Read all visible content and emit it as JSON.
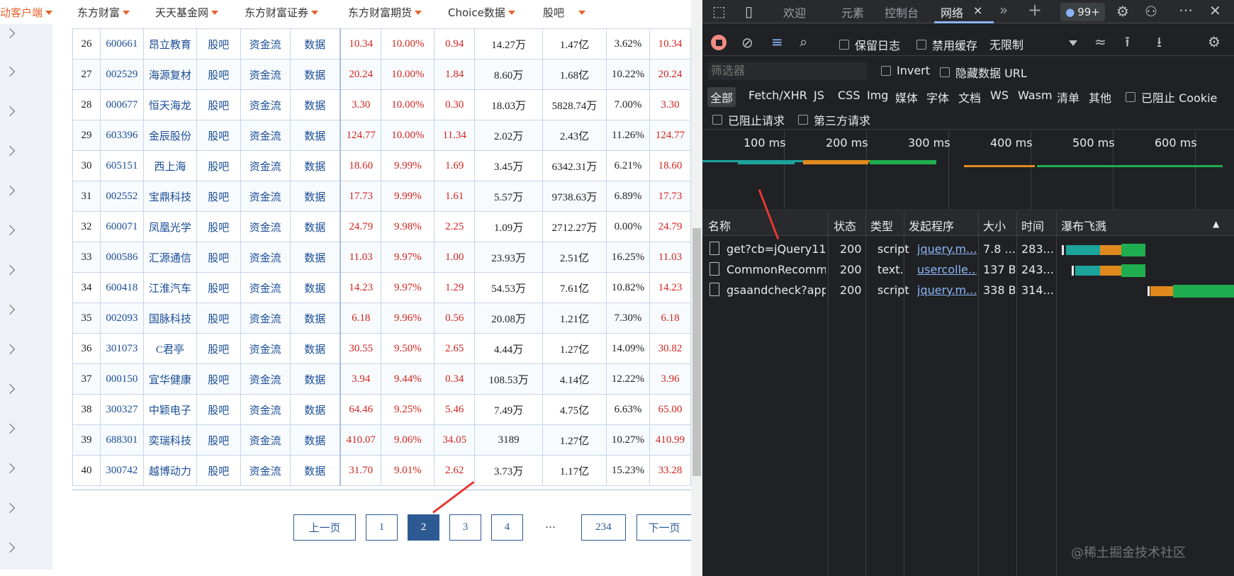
{
  "topnav": {
    "items": [
      "动客户端",
      "东方财富",
      "天天基金网",
      "东方财富证券",
      "东方财富期货",
      "Choice数据",
      "股吧"
    ]
  },
  "table": {
    "rows": [
      [
        "26",
        "600661",
        "昂立教育",
        "股吧",
        "资金流",
        "数据",
        "10.34",
        "10.00%",
        "0.94",
        "14.27万",
        "1.47亿",
        "3.62%",
        "10.34"
      ],
      [
        "27",
        "002529",
        "海源复材",
        "股吧",
        "资金流",
        "数据",
        "20.24",
        "10.00%",
        "1.84",
        "8.60万",
        "1.68亿",
        "10.22%",
        "20.24"
      ],
      [
        "28",
        "000677",
        "恒天海龙",
        "股吧",
        "资金流",
        "数据",
        "3.30",
        "10.00%",
        "0.30",
        "18.03万",
        "5828.74万",
        "7.00%",
        "3.30"
      ],
      [
        "29",
        "603396",
        "金辰股份",
        "股吧",
        "资金流",
        "数据",
        "124.77",
        "10.00%",
        "11.34",
        "2.02万",
        "2.43亿",
        "11.26%",
        "124.77"
      ],
      [
        "30",
        "605151",
        "西上海",
        "股吧",
        "资金流",
        "数据",
        "18.60",
        "9.99%",
        "1.69",
        "3.45万",
        "6342.31万",
        "6.21%",
        "18.60"
      ],
      [
        "31",
        "002552",
        "宝鼎科技",
        "股吧",
        "资金流",
        "数据",
        "17.73",
        "9.99%",
        "1.61",
        "5.57万",
        "9738.63万",
        "6.89%",
        "17.73"
      ],
      [
        "32",
        "600071",
        "凤凰光学",
        "股吧",
        "资金流",
        "数据",
        "24.79",
        "9.98%",
        "2.25",
        "1.09万",
        "2712.27万",
        "0.00%",
        "24.79"
      ],
      [
        "33",
        "000586",
        "汇源通信",
        "股吧",
        "资金流",
        "数据",
        "11.03",
        "9.97%",
        "1.00",
        "23.93万",
        "2.51亿",
        "16.25%",
        "11.03"
      ],
      [
        "34",
        "600418",
        "江淮汽车",
        "股吧",
        "资金流",
        "数据",
        "14.23",
        "9.97%",
        "1.29",
        "54.53万",
        "7.61亿",
        "10.82%",
        "14.23"
      ],
      [
        "35",
        "002093",
        "国脉科技",
        "股吧",
        "资金流",
        "数据",
        "6.18",
        "9.96%",
        "0.56",
        "20.08万",
        "1.21亿",
        "7.30%",
        "6.18"
      ],
      [
        "36",
        "301073",
        "C君亭",
        "股吧",
        "资金流",
        "数据",
        "30.55",
        "9.50%",
        "2.65",
        "4.44万",
        "1.27亿",
        "14.09%",
        "30.82"
      ],
      [
        "37",
        "000150",
        "宜华健康",
        "股吧",
        "资金流",
        "数据",
        "3.94",
        "9.44%",
        "0.34",
        "108.53万",
        "4.14亿",
        "12.22%",
        "3.96"
      ],
      [
        "38",
        "300327",
        "中颖电子",
        "股吧",
        "资金流",
        "数据",
        "64.46",
        "9.25%",
        "5.46",
        "7.49万",
        "4.75亿",
        "6.63%",
        "65.00"
      ],
      [
        "39",
        "688301",
        "奕瑞科技",
        "股吧",
        "资金流",
        "数据",
        "410.07",
        "9.06%",
        "34.05",
        "3189",
        "1.27亿",
        "10.27%",
        "410.99"
      ],
      [
        "40",
        "300742",
        "越博动力",
        "股吧",
        "资金流",
        "数据",
        "31.70",
        "9.01%",
        "2.62",
        "3.73万",
        "1.17亿",
        "15.23%",
        "33.28"
      ]
    ]
  },
  "pager": {
    "prev": "上一页",
    "pages": [
      "1",
      "2",
      "3",
      "4"
    ],
    "dots": "…",
    "last": "234",
    "next": "下一页",
    "current": "2"
  },
  "devtools": {
    "tabs": {
      "welcome": "欢迎",
      "elements": "元素",
      "console": "控制台",
      "network": "网络",
      "close": "×",
      "more": "»",
      "add": "+",
      "badge": "99+"
    },
    "toolbar": {
      "preserve_log": "保留日志",
      "disable_cache": "禁用缓存",
      "throttle": "无限制"
    },
    "filter": {
      "placeholder": "筛选器",
      "invert": "Invert",
      "hide_data_urls": "隐藏数据 URL"
    },
    "types": [
      "全部",
      "Fetch/XHR",
      "JS",
      "CSS",
      "Img",
      "媒体",
      "字体",
      "文档",
      "WS",
      "Wasm",
      "清单",
      "其他"
    ],
    "blocked_cookies": "已阻止 Cookie",
    "blocked_requests": "已阻止请求",
    "third_party": "第三方请求",
    "timeline": [
      "100 ms",
      "200 ms",
      "300 ms",
      "400 ms",
      "500 ms",
      "600 ms"
    ],
    "columns": {
      "name": "名称",
      "status": "状态",
      "type": "类型",
      "initiator": "发起程序",
      "size": "大小",
      "time": "时间",
      "waterfall": "瀑布飞溅"
    },
    "requests": [
      {
        "name": "get?cb=jQuery11...",
        "status": "200",
        "type": "script",
        "initiator": "jquery.m...",
        "size": "7.8 ...",
        "time": "283..."
      },
      {
        "name": "CommonRecomm...",
        "status": "200",
        "type": "text...",
        "initiator": "usercolle...",
        "size": "137 B",
        "time": "243..."
      },
      {
        "name": "gsaandcheck?app...",
        "status": "200",
        "type": "script",
        "initiator": "jquery.m...",
        "size": "338 B",
        "time": "314..."
      }
    ]
  },
  "watermark": "@稀土掘金技术社区",
  "colors": {
    "accent_orange": "#e8612c",
    "link_blue": "#1a4d96",
    "up_red": "#d2241f",
    "pager_blue": "#2e5a93",
    "dt_bg": "#202124",
    "dt_link": "#8ab4f8"
  }
}
